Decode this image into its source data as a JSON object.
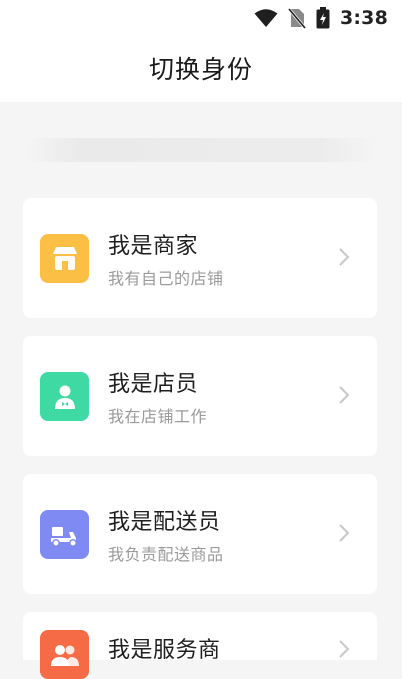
{
  "status": {
    "time": "3:38",
    "icons": [
      "wifi-icon",
      "no-sim-icon",
      "battery-charging-icon"
    ]
  },
  "header": {
    "title": "切换身份"
  },
  "roles": [
    {
      "name": "我是商家",
      "desc": "我有自己的店铺",
      "icon": "store-icon",
      "color": "#fbbf45"
    },
    {
      "name": "我是店员",
      "desc": "我在店铺工作",
      "icon": "clerk-icon",
      "color": "#3fd9a4"
    },
    {
      "name": "我是配送员",
      "desc": "我负责配送商品",
      "icon": "delivery-scooter-icon",
      "color": "#7f8bf2"
    },
    {
      "name": "我是服务商",
      "desc": "",
      "icon": "service-provider-icon",
      "color": "#f56b45"
    }
  ],
  "colors": {
    "chevron": "#c8c8c8",
    "background": "#f5f5f5"
  }
}
